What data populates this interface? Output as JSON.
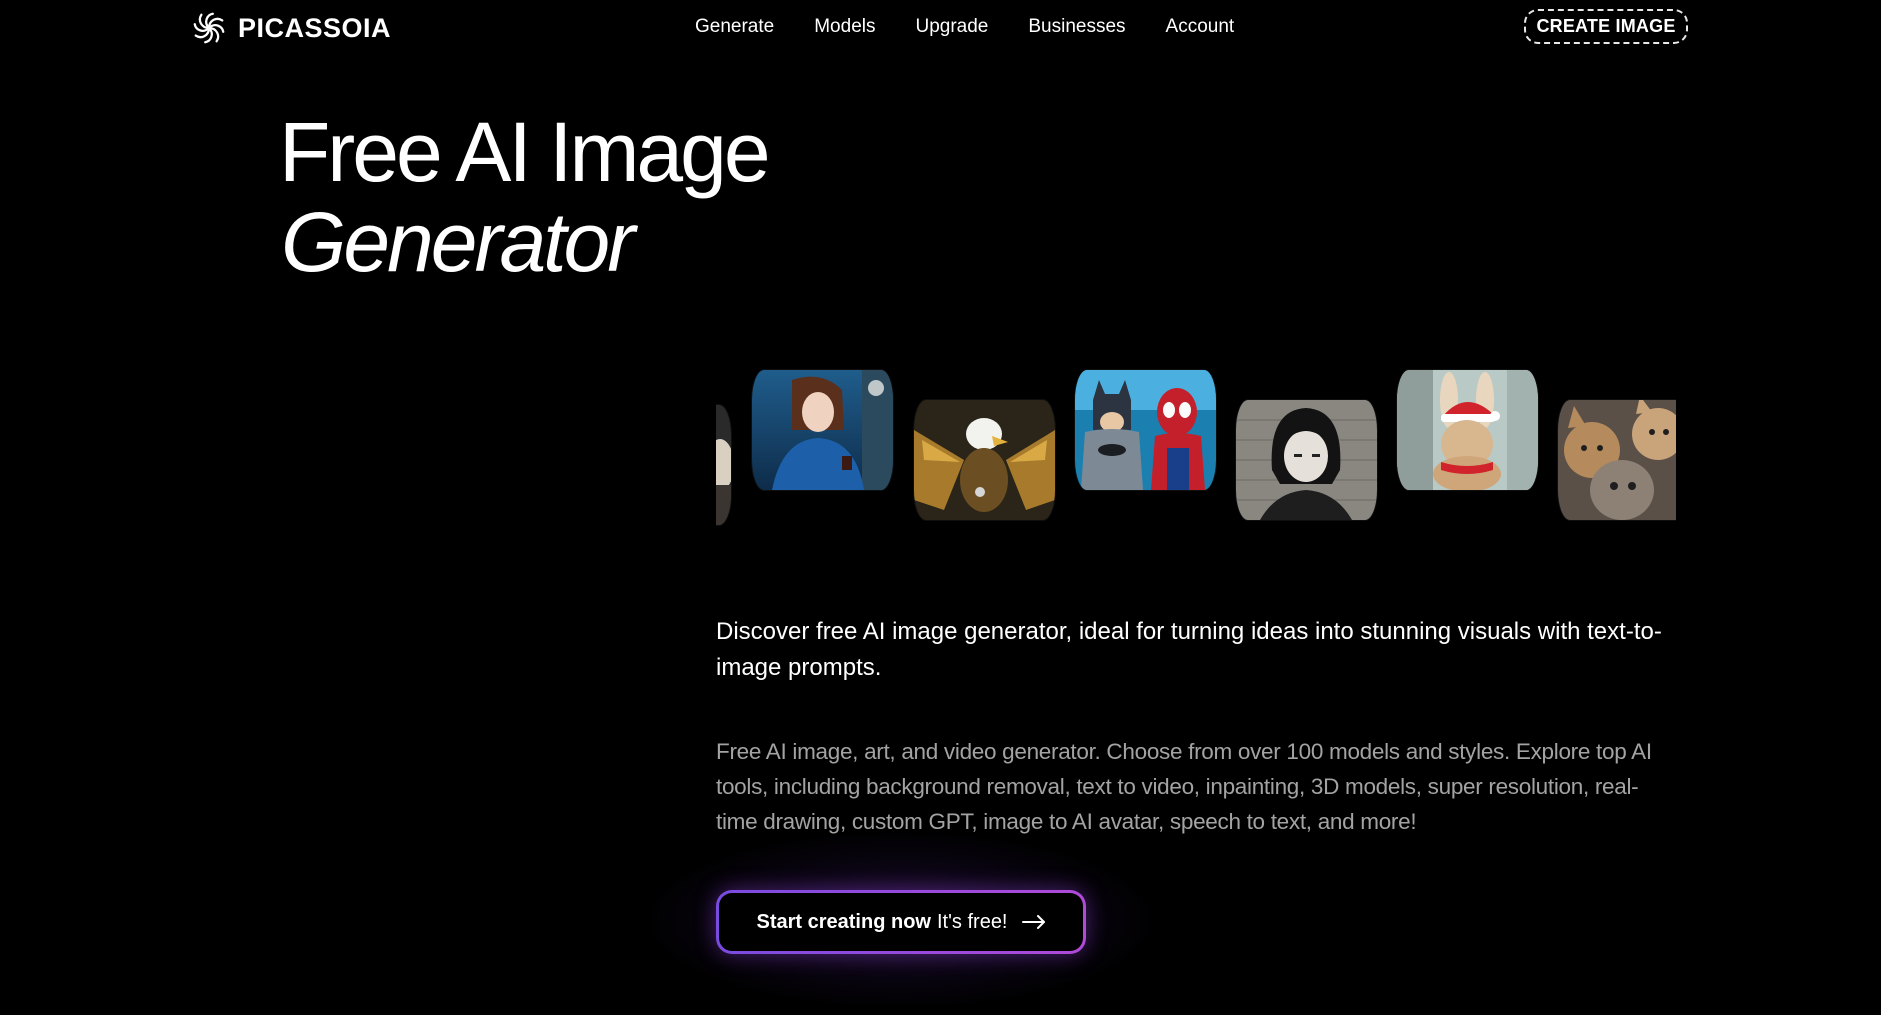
{
  "header": {
    "brand": "PICASSOIA",
    "nav": [
      "Generate",
      "Models",
      "Upgrade",
      "Businesses",
      "Account"
    ],
    "cta_label": "CREATE IMAGE"
  },
  "hero": {
    "title_line1": "Free AI Image",
    "title_line2": "Generator"
  },
  "carousel": {
    "images": [
      "partially-visible-image",
      "woman-in-blue-dress-portrait",
      "golden-eagle-artwork",
      "batman-and-spiderman",
      "anime-girl-black-bob-hair",
      "rabbit-in-santa-hat",
      "cats-selfie"
    ]
  },
  "content": {
    "lead": "Discover free AI image generator, ideal for turning ideas into stunning visuals with text-to-image prompts.",
    "description": "Free AI image, art, and video generator. Choose from over 100 models and styles. Explore top AI tools, including background removal, text to video, inpainting, 3D models, super resolution, real-time drawing, custom GPT, image to AI avatar, speech to text, and more!"
  },
  "cta": {
    "strong": "Start creating now",
    "light": "It's free!",
    "icon": "arrow-right-icon"
  },
  "colors": {
    "background": "#000000",
    "text": "#ffffff",
    "muted_text": "#a3a3a3",
    "accent_gradient_start": "#7a4be0",
    "accent_gradient_end": "#b04ad8"
  }
}
